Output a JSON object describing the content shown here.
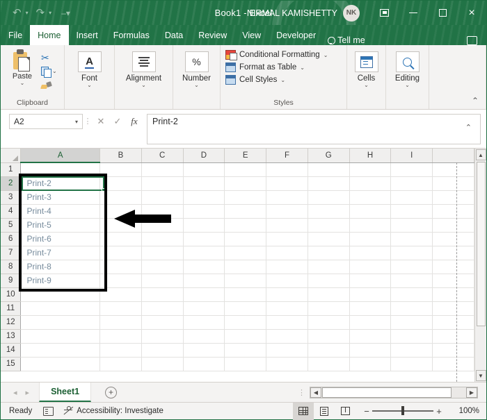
{
  "titlebar": {
    "undo_icon": "undo-arrow-icon",
    "redo_icon": "redo-arrow-icon",
    "customize_qat_icon": "customize-quick-access-toolbar-icon",
    "document_title": "Book1  -  Excel",
    "user_name": "NIRMAL KAMISHETTY",
    "user_initials": "NK",
    "ribbon_display_options_icon": "ribbon-display-options-icon",
    "minimize_label": "minimize-icon",
    "maximize_label": "maximize-icon",
    "close_label": "×"
  },
  "tabs": [
    {
      "label": "File",
      "active": false
    },
    {
      "label": "Home",
      "active": true
    },
    {
      "label": "Insert",
      "active": false
    },
    {
      "label": "Formulas",
      "active": false
    },
    {
      "label": "Data",
      "active": false
    },
    {
      "label": "Review",
      "active": false
    },
    {
      "label": "View",
      "active": false
    },
    {
      "label": "Developer",
      "active": false
    }
  ],
  "tellme": {
    "label": "Tell me",
    "icon": "lightbulb-icon"
  },
  "share": {
    "icon": "comment-share-icon"
  },
  "ribbon": {
    "clipboard": {
      "group_label": "Clipboard",
      "paste_label": "Paste",
      "paste_caret": "⌄",
      "cut_icon": "scissors-cut-icon",
      "copy_icon": "copy-icon",
      "copy_caret": "⌄",
      "format_painter_icon": "format-painter-icon",
      "dialog_launcher": "clipboard-dialog-launcher"
    },
    "font": {
      "label": "Font",
      "caret": "⌄",
      "icon": "font-A-icon"
    },
    "alignment": {
      "label": "Alignment",
      "caret": "⌄",
      "icon": "alignment-lines-icon"
    },
    "number": {
      "label": "Number",
      "caret": "⌄",
      "icon": "%"
    },
    "styles": {
      "group_label": "Styles",
      "items": [
        {
          "label": "Conditional Formatting",
          "caret": "⌄",
          "icon": "conditional-formatting-icon"
        },
        {
          "label": "Format as Table",
          "caret": "⌄",
          "icon": "format-as-table-icon"
        },
        {
          "label": "Cell Styles",
          "caret": "⌄",
          "icon": "cell-styles-icon"
        }
      ]
    },
    "cells": {
      "label": "Cells",
      "caret": "⌄",
      "icon": "cells-insert-icon"
    },
    "editing": {
      "label": "Editing",
      "caret": "⌄",
      "icon": "magnifier-find-icon"
    },
    "collapse_caret": "⌃"
  },
  "formulabar": {
    "namebox_value": "A2",
    "namebox_caret": "▾",
    "cancel_icon": "✕",
    "enter_icon": "✓",
    "fx_icon": "fx",
    "formula_value": "Print-2",
    "expand_caret": "⌃"
  },
  "grid": {
    "columns": [
      "A",
      "B",
      "C",
      "D",
      "E",
      "F",
      "G",
      "H",
      "I"
    ],
    "selected_column": "A",
    "rows": [
      1,
      2,
      3,
      4,
      5,
      6,
      7,
      8,
      9,
      10,
      11,
      12,
      13,
      14,
      15
    ],
    "selected_row": 2,
    "active_cell": "A2",
    "cell_values": {
      "A2": "Print-2",
      "A3": "Print-3",
      "A4": "Print-4",
      "A5": "Print-5",
      "A6": "Print-6",
      "A7": "Print-7",
      "A8": "Print-8",
      "A9": "Print-9"
    },
    "annotation": {
      "highlight_box_range": "A2:A9",
      "arrow_direction": "left",
      "arrow_icon": "black-left-arrow-annotation"
    },
    "print_area_line": true,
    "scroll_up_icon": "▲",
    "scroll_down_icon": "▼"
  },
  "sheetbar": {
    "prev_icon": "◂",
    "next_icon": "▸",
    "sheets": [
      {
        "label": "Sheet1",
        "active": true
      }
    ],
    "add_sheet_icon": "+",
    "hscroll_left_icon": "◀",
    "hscroll_right_icon": "▶"
  },
  "statusbar": {
    "mode": "Ready",
    "macro_record_icon": "record-macro-icon",
    "accessibility_icon": "accessibility-icon",
    "accessibility_text": "Accessibility: Investigate",
    "views": [
      {
        "name": "normal-view",
        "active": true
      },
      {
        "name": "page-layout-view",
        "active": false
      },
      {
        "name": "page-break-preview",
        "active": false
      }
    ],
    "zoom_out_label": "−",
    "zoom_in_label": "+",
    "zoom_level": "100%"
  },
  "colors": {
    "excel_green": "#217346",
    "ribbon_bg": "#f4f3f2",
    "cell_text": "#768b9c",
    "annotation": "#000000"
  }
}
